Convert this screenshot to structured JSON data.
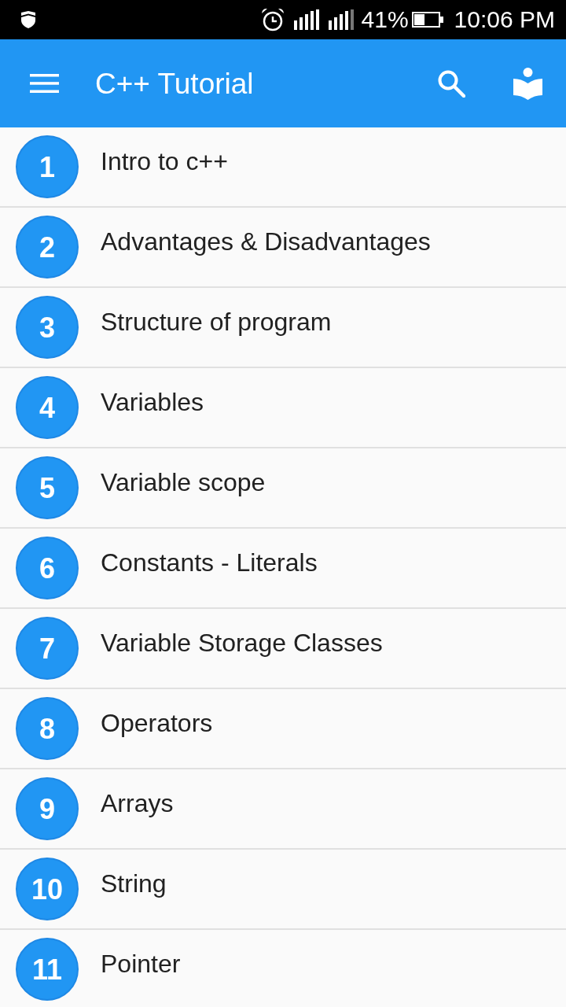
{
  "status_bar": {
    "battery_text": "41%",
    "time": "10:06 PM"
  },
  "app_bar": {
    "title": "C++ Tutorial"
  },
  "lessons": [
    {
      "number": "1",
      "title": "Intro to c++"
    },
    {
      "number": "2",
      "title": "Advantages & Disadvantages"
    },
    {
      "number": "3",
      "title": "Structure of program"
    },
    {
      "number": "4",
      "title": "Variables"
    },
    {
      "number": "5",
      "title": "Variable scope"
    },
    {
      "number": "6",
      "title": "Constants - Literals"
    },
    {
      "number": "7",
      "title": "Variable Storage Classes"
    },
    {
      "number": "8",
      "title": "Operators"
    },
    {
      "number": "9",
      "title": "Arrays"
    },
    {
      "number": "10",
      "title": "String"
    },
    {
      "number": "11",
      "title": "Pointer"
    }
  ]
}
